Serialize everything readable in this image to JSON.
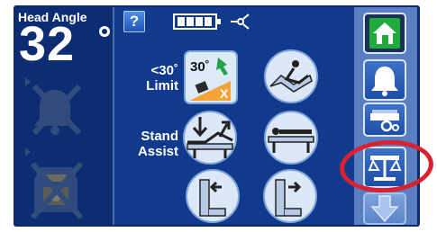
{
  "status": {
    "head_angle_label": "Head Angle",
    "head_angle_value": "32"
  },
  "icons": {
    "help": "help-icon",
    "battery": "battery-icon",
    "plug": "plug-icon",
    "alarm_off": "alarm-off-icon",
    "bed_exit_alarm_off": "bed-exit-alarm-off-icon",
    "home": "home-icon",
    "alarm": "bell-icon",
    "bed_settings": "bed-settings-icon",
    "scale": "scale-icon",
    "scroll_down": "arrow-down-icon"
  },
  "help_button": {
    "label": "?"
  },
  "controls": {
    "limit_label_line1": "<30˚",
    "limit_label_line2": "Limit",
    "limit_icon_angle": "30˚",
    "limit_icon_mark": "X",
    "stand_assist_line1": "Stand",
    "stand_assist_line2": "Assist"
  },
  "colors": {
    "frame": "#0a2a6a",
    "center_panel": "#123a8c",
    "right_panel": "#5a7ec2",
    "highlight_circle": "#d8222f",
    "home_green": "#1faa3c",
    "limit_tile": "#f2a43a"
  }
}
